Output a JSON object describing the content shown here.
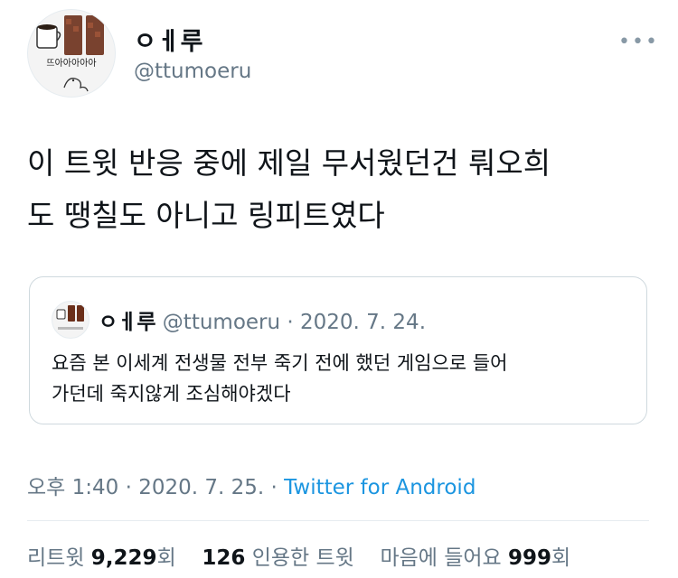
{
  "author": {
    "name": "ㅇㅔ루",
    "handle": "@ttumoeru",
    "avatar_caption": "뜨아아아아아"
  },
  "tweet": {
    "text_line1": "이 트윗 반응 중에 제일 무서웠던건 뤄오희",
    "text_line2": "도 땡칠도 아니고 링피트였다"
  },
  "quote": {
    "name": "ㅇㅔ루",
    "handle": "@ttumoeru",
    "separator": "·",
    "date": "2020. 7. 24.",
    "text_line1": "요즘 본 이세계 전생물 전부 죽기 전에 했던 게임으로 들어",
    "text_line2": "가던데 죽지않게 조심해야겠다"
  },
  "meta": {
    "time": "오후 1:40",
    "separator": "·",
    "date": "2020. 7. 25.",
    "separator2": "·",
    "source": "Twitter for Android"
  },
  "stats": {
    "retweets_label": "리트윗",
    "retweets_count": "9,229",
    "retweets_unit": "회",
    "quotes_count": "126",
    "quotes_label": "인용한 트윗",
    "likes_label": "마음에 들어요",
    "likes_count": "999",
    "likes_unit": "회"
  },
  "icons": {
    "more": "more-horizontal-icon"
  }
}
